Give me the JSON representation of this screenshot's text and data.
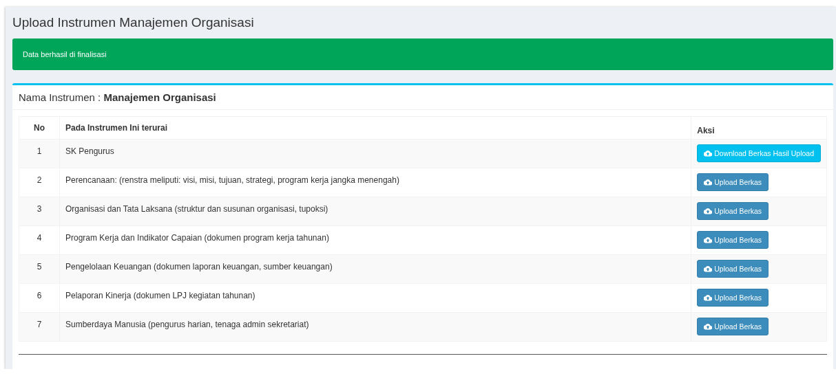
{
  "page_title": "Upload Instrumen Manajemen Organisasi",
  "alert": {
    "text": "Data berhasil di finalisasi"
  },
  "card": {
    "label": "Nama Instrumen :",
    "value": "Manajemen Organisasi"
  },
  "table": {
    "columns": [
      "No",
      "Pada Instrumen Ini terurai",
      "Aksi"
    ],
    "rows": [
      {
        "no": "1",
        "item": "SK Pengurus",
        "action": {
          "kind": "download",
          "label": "Download Berkas Hasil Upload"
        }
      },
      {
        "no": "2",
        "item": "Perencanaan: (renstra meliputi: visi, misi, tujuan, strategi, program kerja jangka menengah)",
        "action": {
          "kind": "upload",
          "label": "Upload Berkas"
        }
      },
      {
        "no": "3",
        "item": "Organisasi dan Tata Laksana (struktur dan susunan organisasi, tupoksi)",
        "action": {
          "kind": "upload",
          "label": "Upload Berkas"
        }
      },
      {
        "no": "4",
        "item": "Program Kerja dan Indikator Capaian (dokumen program kerja tahunan)",
        "action": {
          "kind": "upload",
          "label": "Upload Berkas"
        }
      },
      {
        "no": "5",
        "item": "Pengelolaan Keuangan (dokumen laporan keuangan, sumber keuangan)",
        "action": {
          "kind": "upload",
          "label": "Upload Berkas"
        }
      },
      {
        "no": "6",
        "item": "Pelaporan Kinerja (dokumen LPJ kegiatan tahunan)",
        "action": {
          "kind": "upload",
          "label": "Upload Berkas"
        }
      },
      {
        "no": "7",
        "item": "Sumberdaya Manusia (pengurus harian, tenaga admin sekretariat)",
        "action": {
          "kind": "upload",
          "label": "Upload Berkas"
        }
      }
    ]
  }
}
